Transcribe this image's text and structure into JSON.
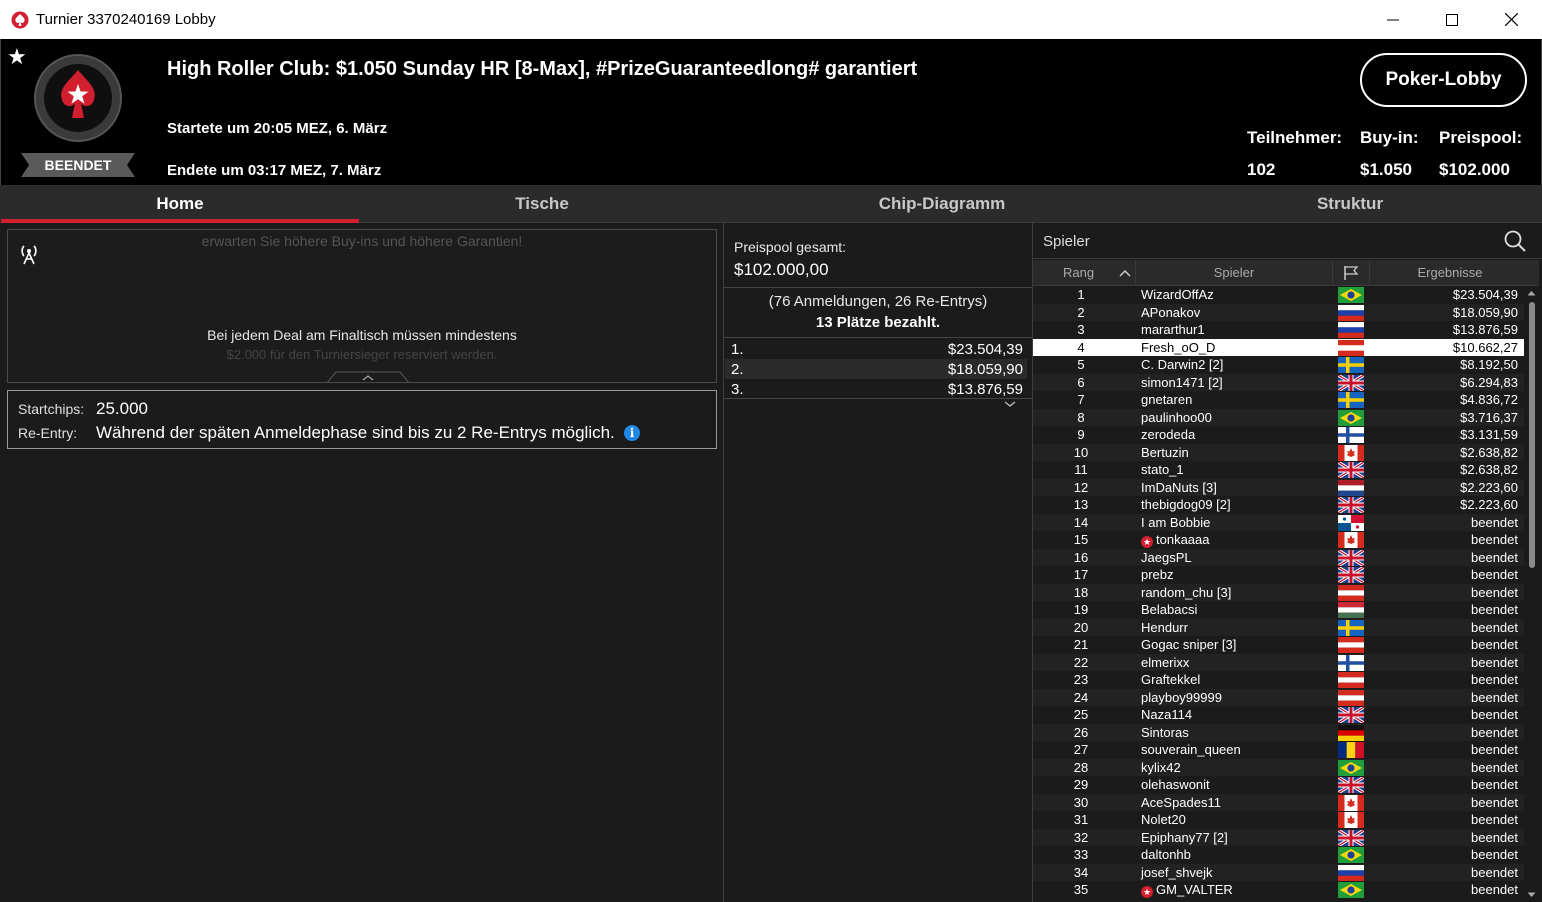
{
  "window": {
    "title": "Turnier 3370240169 Lobby",
    "controls": {
      "minimize": "—",
      "maximize": "☐",
      "close": "✕"
    }
  },
  "header": {
    "status": "BEENDET",
    "title": "High Roller Club: $1.050 Sunday HR [8-Max], #PrizeGuaranteedlong# garantiert",
    "started": "Startete um 20:05 MEZ, 6. März",
    "ended": "Endete um 03:17 MEZ, 7. März",
    "lobby_button": "Poker-Lobby",
    "stats": {
      "participants_label": "Teilnehmer:",
      "participants_value": "102",
      "buyin_label": "Buy-in:",
      "buyin_value": "$1.050",
      "prizepool_label": "Preispool:",
      "prizepool_value": "$102.000"
    }
  },
  "tabs": [
    {
      "label": "Home",
      "active": true
    },
    {
      "label": "Tische",
      "active": false
    },
    {
      "label": "Chip-Diagramm",
      "active": false
    },
    {
      "label": "Struktur",
      "active": false
    }
  ],
  "news": {
    "faded_top": "erwarten Sie höhere Buy-ins und höhere Garantien!",
    "line": "Bei jedem Deal am Finaltisch müssen mindestens",
    "faded_bottom": "$2.000 für den Turniersieger reserviert werden."
  },
  "info": {
    "startchips_label": "Startchips:",
    "startchips_value": "25.000",
    "reentry_label": "Re-Entry:",
    "reentry_value": "Während der späten Anmeldephase sind bis zu 2 Re-Entrys möglich.",
    "info_glyph": "i"
  },
  "prizepool": {
    "label": "Preispool gesamt:",
    "value": "$102.000,00",
    "entries": "(76 Anmeldungen, 26 Re-Entrys)",
    "paid": "13 Plätze bezahlt.",
    "places": [
      {
        "pos": "1.",
        "amount": "$23.504,39"
      },
      {
        "pos": "2.",
        "amount": "$18.059,90"
      },
      {
        "pos": "3.",
        "amount": "$13.876,59"
      }
    ]
  },
  "players": {
    "search_label": "Spieler",
    "columns": {
      "rank": "Rang",
      "player": "Spieler",
      "result": "Ergebnisse"
    },
    "selected_rank": "4",
    "rows": [
      {
        "rank": "1",
        "name": "WizardOffAz",
        "flag": "br",
        "result": "$23.504,39",
        "star": false
      },
      {
        "rank": "2",
        "name": "APonakov",
        "flag": "ru",
        "result": "$18.059,90",
        "star": false
      },
      {
        "rank": "3",
        "name": "mararthur1",
        "flag": "ru",
        "result": "$13.876,59",
        "star": false
      },
      {
        "rank": "4",
        "name": "Fresh_oO_D",
        "flag": "at",
        "result": "$10.662,27",
        "star": false
      },
      {
        "rank": "5",
        "name": "C. Darwin2 [2]",
        "flag": "se",
        "result": "$8.192,50",
        "star": false
      },
      {
        "rank": "6",
        "name": "simon1471 [2]",
        "flag": "gb",
        "result": "$6.294,83",
        "star": false
      },
      {
        "rank": "7",
        "name": "gnetaren",
        "flag": "se",
        "result": "$4.836,72",
        "star": false
      },
      {
        "rank": "8",
        "name": "paulinhoo00",
        "flag": "br",
        "result": "$3.716,37",
        "star": false
      },
      {
        "rank": "9",
        "name": "zerodeda",
        "flag": "fi",
        "result": "$3.131,59",
        "star": false
      },
      {
        "rank": "10",
        "name": "Bertuzin",
        "flag": "ca",
        "result": "$2.638,82",
        "star": false
      },
      {
        "rank": "11",
        "name": "stato_1",
        "flag": "gb",
        "result": "$2.638,82",
        "star": false
      },
      {
        "rank": "12",
        "name": "ImDaNuts [3]",
        "flag": "nl",
        "result": "$2.223,60",
        "star": false
      },
      {
        "rank": "13",
        "name": "thebigdog09 [2]",
        "flag": "gb",
        "result": "$2.223,60",
        "star": false
      },
      {
        "rank": "14",
        "name": "I am Bobbie",
        "flag": "pa",
        "result": "beendet",
        "star": false
      },
      {
        "rank": "15",
        "name": "tonkaaaa",
        "flag": "ca",
        "result": "beendet",
        "star": true
      },
      {
        "rank": "16",
        "name": "JaegsPL",
        "flag": "gb",
        "result": "beendet",
        "star": false
      },
      {
        "rank": "17",
        "name": "prebz",
        "flag": "gb",
        "result": "beendet",
        "star": false
      },
      {
        "rank": "18",
        "name": "random_chu [3]",
        "flag": "at",
        "result": "beendet",
        "star": false
      },
      {
        "rank": "19",
        "name": "Belabacsi",
        "flag": "hu",
        "result": "beendet",
        "star": false
      },
      {
        "rank": "20",
        "name": "Hendurr",
        "flag": "se",
        "result": "beendet",
        "star": false
      },
      {
        "rank": "21",
        "name": "Gogac sniper [3]",
        "flag": "at",
        "result": "beendet",
        "star": false
      },
      {
        "rank": "22",
        "name": "elmerixx",
        "flag": "fi",
        "result": "beendet",
        "star": false
      },
      {
        "rank": "23",
        "name": "Graftekkel",
        "flag": "at",
        "result": "beendet",
        "star": false
      },
      {
        "rank": "24",
        "name": "playboy99999",
        "flag": "at",
        "result": "beendet",
        "star": false
      },
      {
        "rank": "25",
        "name": "Naza114",
        "flag": "gb",
        "result": "beendet",
        "star": false
      },
      {
        "rank": "26",
        "name": "Sintoras",
        "flag": "de",
        "result": "beendet",
        "star": false
      },
      {
        "rank": "27",
        "name": "souverain_queen",
        "flag": "ro",
        "result": "beendet",
        "star": false
      },
      {
        "rank": "28",
        "name": "kylix42",
        "flag": "br",
        "result": "beendet",
        "star": false
      },
      {
        "rank": "29",
        "name": "olehaswonit",
        "flag": "gb",
        "result": "beendet",
        "star": false
      },
      {
        "rank": "30",
        "name": "AceSpades11",
        "flag": "ca",
        "result": "beendet",
        "star": false
      },
      {
        "rank": "31",
        "name": "Nolet20",
        "flag": "ca",
        "result": "beendet",
        "star": false
      },
      {
        "rank": "32",
        "name": "Epiphany77 [2]",
        "flag": "gb",
        "result": "beendet",
        "star": false
      },
      {
        "rank": "33",
        "name": "daltonhb",
        "flag": "br",
        "result": "beendet",
        "star": false
      },
      {
        "rank": "34",
        "name": "josef_shvejk",
        "flag": "ru",
        "result": "beendet",
        "star": false
      },
      {
        "rank": "35",
        "name": "GM_VALTER",
        "flag": "br",
        "result": "beendet",
        "star": true
      }
    ]
  },
  "colors": {
    "accent_red": "#d11f2f",
    "header_bg": "#000000",
    "panel_bg": "#1b1b1b",
    "info_blue": "#1e88e5"
  }
}
